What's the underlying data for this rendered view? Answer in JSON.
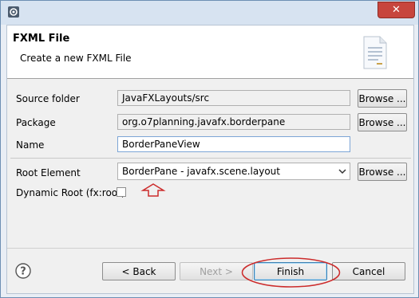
{
  "window": {
    "close_glyph": "✕",
    "icon": "gear-icon"
  },
  "header": {
    "title": "FXML File",
    "subtitle": "Create a new FXML File",
    "icon": "document-icon"
  },
  "form": {
    "source_folder": {
      "label": "Source folder",
      "value": "JavaFXLayouts/src",
      "button": "Browse ..."
    },
    "package": {
      "label": "Package",
      "value": "org.o7planning.javafx.borderpane",
      "button": "Browse ..."
    },
    "name": {
      "label": "Name",
      "value": "BorderPaneView"
    },
    "root_element": {
      "label": "Root Element",
      "value": "BorderPane - javafx.scene.layout",
      "button": "Browse ..."
    },
    "dynamic_root": {
      "label": "Dynamic Root (fx:root)",
      "checked": false
    }
  },
  "footer": {
    "back": "< Back",
    "next": "Next >",
    "finish": "Finish",
    "cancel": "Cancel"
  },
  "colors": {
    "annotation": "#cc2b2b",
    "close_button": "#c7453d",
    "default_button_border": "#3c7fb1"
  }
}
